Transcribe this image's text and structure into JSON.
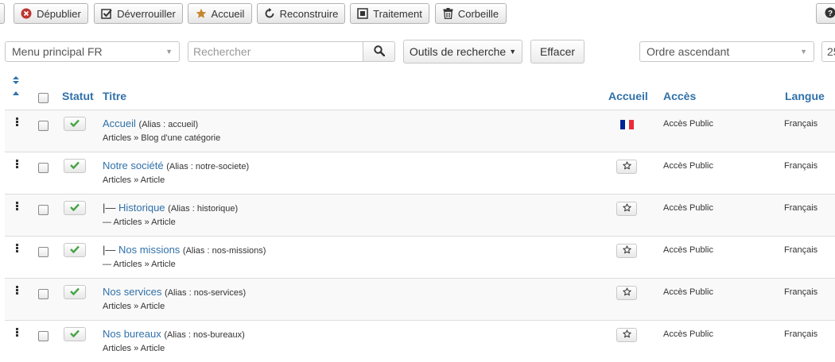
{
  "toolbar": {
    "buttons": [
      {
        "label": "Dépublier",
        "icon": "unpublish-icon"
      },
      {
        "label": "Déverrouiller",
        "icon": "checkin-icon"
      },
      {
        "label": "Accueil",
        "icon": "star-icon"
      },
      {
        "label": "Reconstruire",
        "icon": "refresh-icon"
      },
      {
        "label": "Traitement",
        "icon": "batch-icon"
      },
      {
        "label": "Corbeille",
        "icon": "trash-icon"
      }
    ],
    "help_icon": "question-icon"
  },
  "filters": {
    "menu_select": "Menu principal FR",
    "search_placeholder": "Rechercher",
    "search_tools_label": "Outils de recherche",
    "clear_label": "Effacer",
    "ordering_select": "Ordre ascendant",
    "limit_value": "25"
  },
  "table": {
    "columns": {
      "status": "Statut",
      "title": "Titre",
      "home": "Accueil",
      "access": "Accès",
      "language": "Langue"
    },
    "rows": [
      {
        "prefix": "",
        "title": "Accueil",
        "alias": "(Alias : accueil)",
        "type": "Articles » Blog d'une catégorie",
        "home": "flag",
        "access": "Accès Public",
        "language": "Français"
      },
      {
        "prefix": "",
        "title": "Notre société",
        "alias": "(Alias : notre-societe)",
        "type": "Articles » Article",
        "home": "star",
        "access": "Accès Public",
        "language": "Français"
      },
      {
        "prefix": "|— ",
        "title": "Historique",
        "alias": "(Alias : historique)",
        "type": "— Articles » Article",
        "home": "star",
        "access": "Accès Public",
        "language": "Français"
      },
      {
        "prefix": "|— ",
        "title": "Nos missions",
        "alias": "(Alias : nos-missions)",
        "type": "— Articles » Article",
        "home": "star",
        "access": "Accès Public",
        "language": "Français"
      },
      {
        "prefix": "",
        "title": "Nos services",
        "alias": "(Alias : nos-services)",
        "type": "Articles » Article",
        "home": "star",
        "access": "Accès Public",
        "language": "Français"
      },
      {
        "prefix": "",
        "title": "Nos bureaux",
        "alias": "(Alias : nos-bureaux)",
        "type": "Articles » Article",
        "home": "star",
        "access": "Accès Public",
        "language": "Français"
      }
    ]
  },
  "colors": {
    "link": "#3071a9",
    "published": "#46a546",
    "star": "#e8a317"
  }
}
